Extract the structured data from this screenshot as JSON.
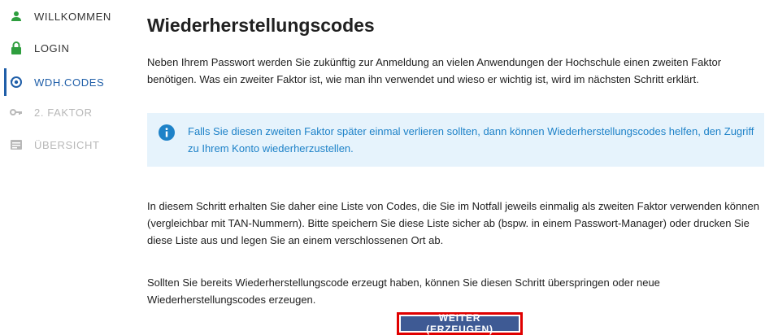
{
  "sidebar": {
    "items": [
      {
        "label": "WILLKOMMEN",
        "icon": "person-icon",
        "state": "done"
      },
      {
        "label": "LOGIN",
        "icon": "lock-icon",
        "state": "done"
      },
      {
        "label": "WDH.CODES",
        "icon": "restore-icon",
        "state": "active"
      },
      {
        "label": "2. FAKTOR",
        "icon": "key-icon",
        "state": "disabled"
      },
      {
        "label": "ÜBERSICHT",
        "icon": "list-icon",
        "state": "disabled"
      }
    ]
  },
  "main": {
    "title": "Wiederherstellungscodes",
    "intro": "Neben Ihrem Passwort werden Sie zukünftig zur Anmeldung an vielen Anwendungen der Hochschule einen zweiten Faktor benötigen. Was ein zweiter Faktor ist, wie man ihn verwendet und wieso er wichtig ist, wird im nächsten Schritt erklärt.",
    "info": "Falls Sie diesen zweiten Faktor später einmal verlieren sollten, dann können Wiederherstellungscodes helfen, den Zugriff zu Ihrem Konto wiederherzustellen.",
    "explanation": "In diesem Schritt erhalten Sie daher eine Liste von Codes, die Sie im Notfall jeweils einmalig als zweiten Faktor verwenden können (vergleichbar mit TAN-Nummern). Bitte speichern Sie diese Liste sicher ab (bspw. in einem Passwort-Manager) oder drucken Sie diese Liste aus und legen Sie an einem verschlossenen Ort ab.",
    "skip_note": "Sollten Sie bereits Wiederherstellungscode erzeugt haben, können Sie diesen Schritt überspringen oder neue Wiederherstellungscodes erzeugen.",
    "button_label": "WEITER (ERZEUGEN)"
  },
  "colors": {
    "done_icon": "#2e9e3e",
    "active": "#1f5ea8",
    "disabled": "#b8b8b8",
    "info_bg": "#e6f3fc",
    "info_text": "#1e82c8",
    "button_bg": "#3e5a94",
    "highlight": "#e00000"
  }
}
